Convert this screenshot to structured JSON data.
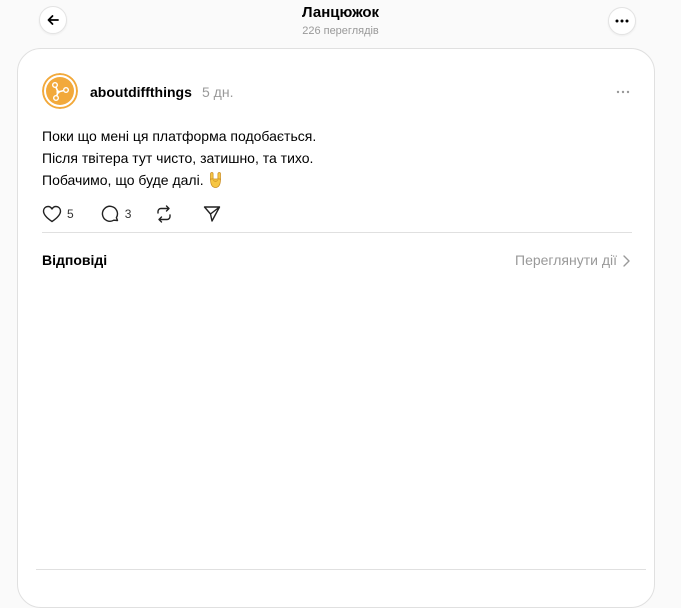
{
  "header": {
    "title": "Ланцюжок",
    "views": "226 переглядів"
  },
  "post": {
    "username": "aboutdiffthings",
    "time": "5 дн.",
    "lines": [
      "Поки що мені ця платформа подобається.",
      "Після твітера тут чисто, затишно, та тихо.",
      "Побачимо, що буде далі."
    ],
    "emoji": "🤘",
    "likes": "5",
    "comments": "3"
  },
  "replies": {
    "label": "Відповіді",
    "view_activity": "Переглянути дії"
  },
  "icons": {
    "back": "arrow-left-icon",
    "more": "more-horizontal-icon",
    "like": "heart-icon",
    "comment": "comment-bubble-icon",
    "repost": "repost-icon",
    "share": "send-icon",
    "chevron": "chevron-right-icon"
  },
  "colors": {
    "background": "#fafafa",
    "card": "#ffffff",
    "muted_text": "#999999",
    "avatar_accent": "#f2a93b"
  }
}
